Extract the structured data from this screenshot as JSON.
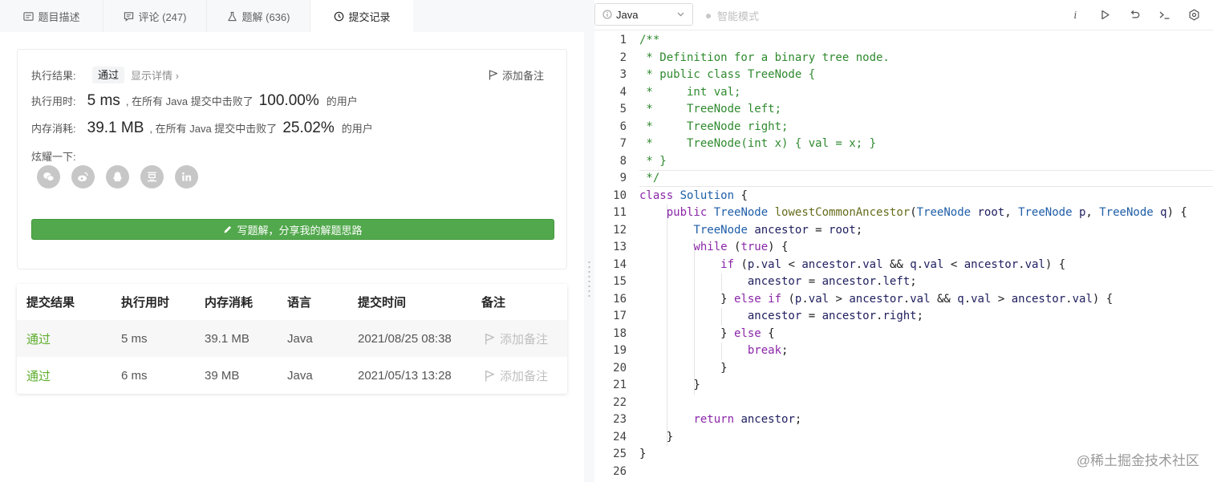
{
  "tabs": [
    {
      "label": "题目描述",
      "icon": "description-icon"
    },
    {
      "label": "评论 (247)",
      "icon": "comment-icon"
    },
    {
      "label": "题解 (636)",
      "icon": "flask-icon"
    },
    {
      "label": "提交记录",
      "icon": "clock-icon"
    }
  ],
  "result": {
    "label": "执行结果:",
    "status": "通过",
    "detail_link": "显示详情 ›",
    "add_note": "添加备注",
    "time_label": "执行用时:",
    "time_value": "5 ms",
    "time_mid": ", 在所有 Java 提交中击败了",
    "time_pct": "100.00%",
    "time_tail": "的用户",
    "mem_label": "内存消耗:",
    "mem_value": "39.1 MB",
    "mem_mid": ", 在所有 Java 提交中击败了",
    "mem_pct": "25.02%",
    "mem_tail": "的用户",
    "share_label": "炫耀一下:",
    "share_icons": [
      "wechat-icon",
      "weibo-icon",
      "qq-icon",
      "douban-icon",
      "linkedin-icon"
    ],
    "write_button": "写题解，分享我的解题思路"
  },
  "submissions": {
    "headers": [
      "提交结果",
      "执行用时",
      "内存消耗",
      "语言",
      "提交时间",
      "备注"
    ],
    "rows": [
      {
        "status": "通过",
        "time": "5 ms",
        "memory": "39.1 MB",
        "lang": "Java",
        "submitted": "2021/08/25 08:38",
        "note": "添加备注"
      },
      {
        "status": "通过",
        "time": "6 ms",
        "memory": "39 MB",
        "lang": "Java",
        "submitted": "2021/05/13 13:28",
        "note": "添加备注"
      }
    ]
  },
  "editor": {
    "language": "Java",
    "smart_mode": "智能模式",
    "toolbar_icons": [
      "info-icon",
      "run-icon",
      "reset-icon",
      "console-icon",
      "settings-icon"
    ],
    "line_numbers": [
      "1",
      "2",
      "3",
      "4",
      "5",
      "6",
      "7",
      "8",
      "9",
      "10",
      "11",
      "12",
      "13",
      "14",
      "15",
      "16",
      "17",
      "18",
      "19",
      "20",
      "21",
      "22",
      "23",
      "24",
      "25",
      "26"
    ],
    "code": [
      "/**",
      " * Definition for a binary tree node.",
      " * public class TreeNode {",
      " *     int val;",
      " *     TreeNode left;",
      " *     TreeNode right;",
      " *     TreeNode(int x) { val = x; }",
      " * }",
      " */",
      "class Solution {",
      "    public TreeNode lowestCommonAncestor(TreeNode root, TreeNode p, TreeNode q) {",
      "        TreeNode ancestor = root;",
      "        while (true) {",
      "            if (p.val < ancestor.val && q.val < ancestor.val) {",
      "                ancestor = ancestor.left;",
      "            } else if (p.val > ancestor.val && q.val > ancestor.val) {",
      "                ancestor = ancestor.right;",
      "            } else {",
      "                break;",
      "            }",
      "        }",
      "",
      "        return ancestor;",
      "    }",
      "}",
      ""
    ]
  },
  "watermark": "@稀土掘金技术社区"
}
